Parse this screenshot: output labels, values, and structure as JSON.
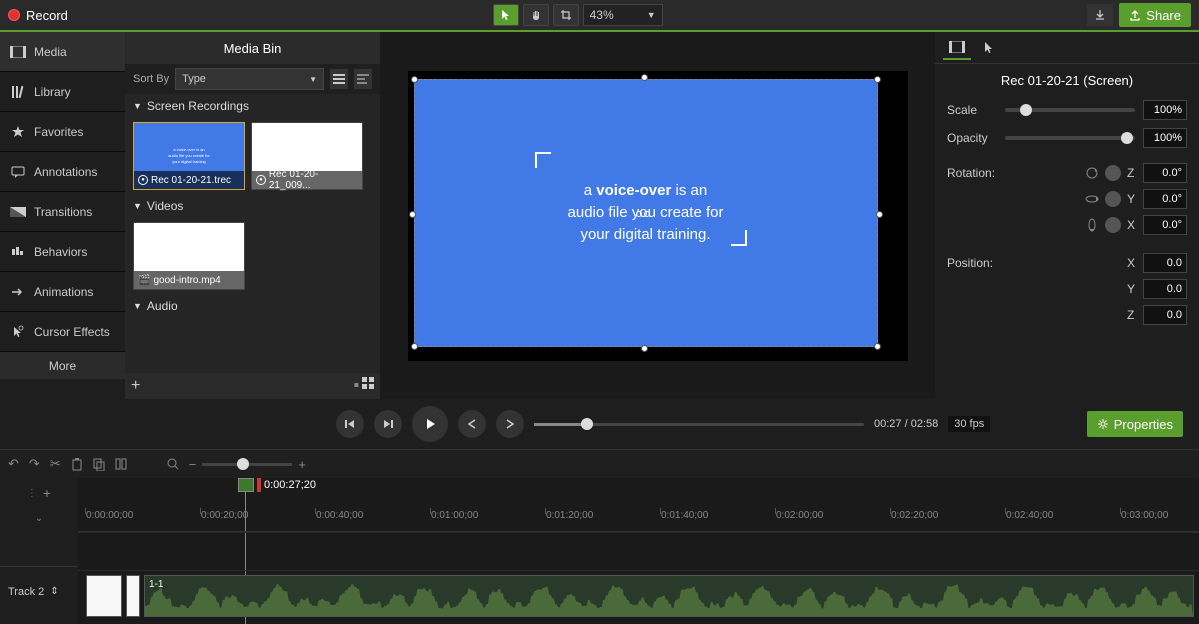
{
  "topbar": {
    "record_label": "Record",
    "zoom_value": "43%",
    "share_label": "Share"
  },
  "sidebar": {
    "items": [
      {
        "label": "Media"
      },
      {
        "label": "Library"
      },
      {
        "label": "Favorites"
      },
      {
        "label": "Annotations"
      },
      {
        "label": "Transitions"
      },
      {
        "label": "Behaviors"
      },
      {
        "label": "Animations"
      },
      {
        "label": "Cursor Effects"
      }
    ],
    "more_label": "More"
  },
  "media_bin": {
    "title": "Media Bin",
    "sort_by_label": "Sort By",
    "sort_value": "Type",
    "sections": {
      "screen_recordings": {
        "title": "Screen Recordings",
        "items": [
          {
            "name": "Rec 01-20-21.trec"
          },
          {
            "name": "Rec 01-20-21_009..."
          }
        ]
      },
      "videos": {
        "title": "Videos",
        "items": [
          {
            "name": "good-intro.mp4"
          }
        ]
      },
      "audio": {
        "title": "Audio"
      }
    }
  },
  "canvas": {
    "slide_text_1": "a ",
    "slide_text_bold": "voice-over",
    "slide_text_2": " is an",
    "slide_text_3": "audio file you create for",
    "slide_text_4": "your digital training."
  },
  "properties": {
    "title": "Rec 01-20-21 (Screen)",
    "scale_label": "Scale",
    "scale_value": "100%",
    "opacity_label": "Opacity",
    "opacity_value": "100%",
    "rotation_label": "Rotation:",
    "rot_z": "0.0°",
    "rot_y": "0.0°",
    "rot_x": "0.0°",
    "position_label": "Position:",
    "pos_x": "0.0",
    "pos_y": "0.0",
    "pos_z": "0.0",
    "axis_z": "Z",
    "axis_y": "Y",
    "axis_x": "X"
  },
  "playback": {
    "time": "00:27 / 02:58",
    "fps": "30 fps",
    "properties_label": "Properties"
  },
  "timeline": {
    "playhead_time": "0:00:27;20",
    "ticks": [
      "0:00:00;00",
      "0:00:20;00",
      "0:00:40;00",
      "0:01:00;00",
      "0:01:20;00",
      "0:01:40;00",
      "0:02:00;00",
      "0:02:20;00",
      "0:02:40;00",
      "0:03:00;00"
    ],
    "track2_label": "Track 2",
    "clip_label": "1-1"
  }
}
